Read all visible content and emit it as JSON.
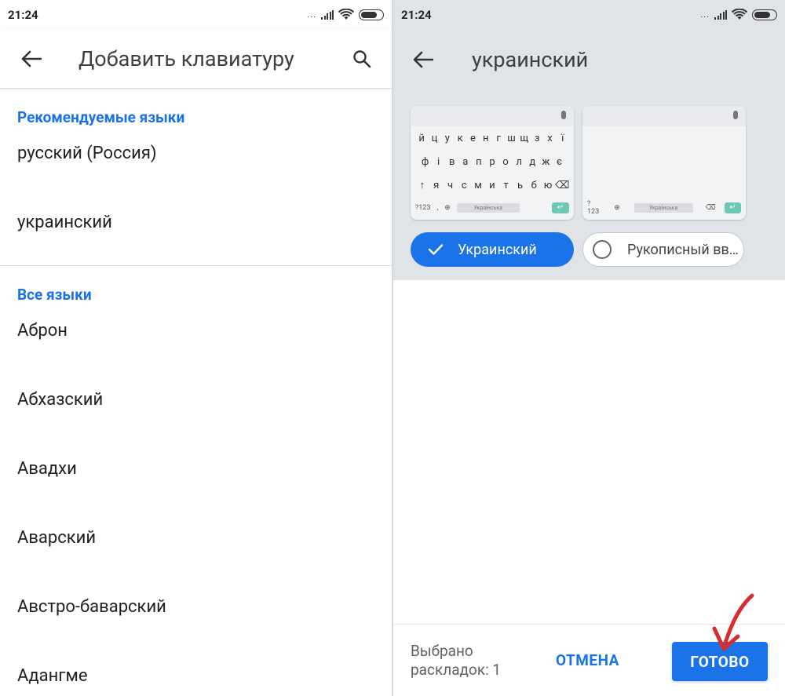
{
  "left": {
    "status": {
      "time": "21:24",
      "dots": "..."
    },
    "appbar": {
      "title": "Добавить клавиатуру"
    },
    "recommended": {
      "header": "Рекомендуемые языки",
      "items": [
        "русский (Россия)",
        "украинский"
      ]
    },
    "all": {
      "header": "Все языки",
      "items": [
        "Аброн",
        "Абхазский",
        "Авадхи",
        "Аварский",
        "Австро-баварский",
        "Адангме"
      ]
    }
  },
  "right": {
    "status": {
      "time": "21:24",
      "dots": "..."
    },
    "appbar": {
      "title": "украинский"
    },
    "keyboard_preview": {
      "row1": [
        "й",
        "ц",
        "у",
        "к",
        "е",
        "н",
        "г",
        "ш",
        "щ",
        "з",
        "х",
        "ї"
      ],
      "row2": [
        "ф",
        "і",
        "в",
        "а",
        "п",
        "р",
        "о",
        "л",
        "д",
        "ж",
        "є"
      ],
      "row3": [
        "↑",
        "я",
        "ч",
        "с",
        "м",
        "и",
        "т",
        "ь",
        "б",
        "ю",
        "⌫"
      ],
      "numkey": "?123",
      "comma": ",",
      "space_label": "Українська",
      "space_label_blank": "Українська",
      "enter": "↵",
      "globe": "⊕"
    },
    "chips": {
      "selected_label": "Украинский",
      "unselected_label": "Рукописный вв…"
    },
    "footer": {
      "count_line1": "Выбрано",
      "count_line2": "раскладок: 1",
      "cancel_label": "ОТМЕНА",
      "done_label": "ГОТОВО"
    }
  },
  "colors": {
    "accent": "#1a73e8",
    "annotation": "#d32f2f"
  }
}
